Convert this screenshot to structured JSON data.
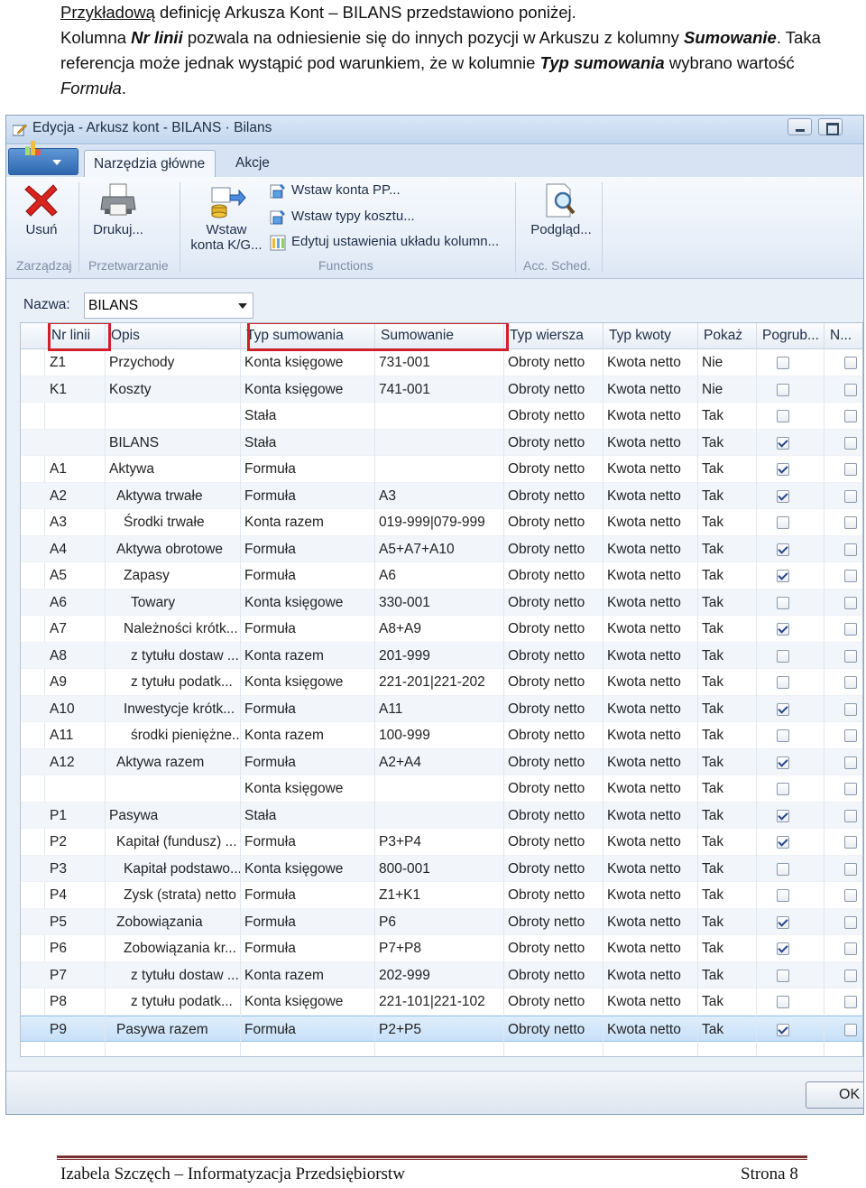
{
  "document": {
    "p1": {
      "underlined": "Przykładową",
      "rest": " definicję Arkusza Kont – BILANS przedstawiono poniżej."
    },
    "p2": {
      "t1": "Kolumna ",
      "b1": "Nr linii",
      "t2": " pozwala na odniesienie się do innych pozycji w Arkuszu z kolumny ",
      "b2": "Sumowanie",
      "t3": ". Taka referencja może jednak wystąpić pod warunkiem, że w kolumnie ",
      "b3": "Typ sumowania",
      "t4": " wybrano wartość ",
      "i1": "Formuła",
      "t5": "."
    }
  },
  "window": {
    "title": "Edycja - Arkusz kont - BILANS · Bilans",
    "tabs": [
      "Narzędzia główne",
      "Akcje"
    ],
    "ribbon": {
      "delete_label": "Usuń",
      "print_label": "Drukuj...",
      "insert_accounts_line1": "Wstaw",
      "insert_accounts_line2": "konta K/G...",
      "insert_pp_label": "Wstaw konta PP...",
      "insert_cost_types_label": "Wstaw typy kosztu...",
      "edit_layout_label": "Edytuj ustawienia układu kolumn...",
      "preview_label": "Podgląd...",
      "groups": {
        "manage": "Zarządzaj",
        "process": "Przetwarzanie",
        "functions": "Functions",
        "acc_sched": "Acc. Sched."
      }
    },
    "name_label": "Nazwa:",
    "name_value": "BILANS",
    "ok_label": "OK"
  },
  "grid": {
    "headers": [
      "Nr linii",
      "Opis",
      "Typ sumowania",
      "Sumowanie",
      "Typ wiersza",
      "Typ kwoty",
      "Pokaż",
      "Pogrub...",
      "N..."
    ],
    "rows": [
      {
        "nr": "Z1",
        "opis": "Przychody",
        "typ": "Konta księgowe",
        "sum": "731-001",
        "wiersz": "Obroty netto",
        "kwota": "Kwota netto",
        "pokaz": "Nie",
        "bold": false,
        "n": false
      },
      {
        "nr": "K1",
        "opis": "Koszty",
        "typ": "Konta księgowe",
        "sum": "741-001",
        "wiersz": "Obroty netto",
        "kwota": "Kwota netto",
        "pokaz": "Nie",
        "bold": false,
        "n": false
      },
      {
        "nr": "",
        "opis": "",
        "typ": "Stała",
        "sum": "",
        "wiersz": "Obroty netto",
        "kwota": "Kwota netto",
        "pokaz": "Tak",
        "bold": false,
        "n": false
      },
      {
        "nr": "",
        "opis": "BILANS",
        "typ": "Stała",
        "sum": "",
        "wiersz": "Obroty netto",
        "kwota": "Kwota netto",
        "pokaz": "Tak",
        "bold": true,
        "n": false
      },
      {
        "nr": "A1",
        "opis": "Aktywa",
        "typ": "Formuła",
        "sum": "",
        "wiersz": "Obroty netto",
        "kwota": "Kwota netto",
        "pokaz": "Tak",
        "bold": true,
        "n": false
      },
      {
        "nr": "A2",
        "opis": "Aktywa trwałe",
        "typ": "Formuła",
        "sum": "A3",
        "wiersz": "Obroty netto",
        "kwota": "Kwota netto",
        "pokaz": "Tak",
        "bold": true,
        "n": false
      },
      {
        "nr": "A3",
        "opis": "Środki trwałe",
        "typ": "Konta razem",
        "sum": "019-999|079-999",
        "wiersz": "Obroty netto",
        "kwota": "Kwota netto",
        "pokaz": "Tak",
        "bold": false,
        "n": false
      },
      {
        "nr": "A4",
        "opis": "Aktywa obrotowe",
        "typ": "Formuła",
        "sum": "A5+A7+A10",
        "wiersz": "Obroty netto",
        "kwota": "Kwota netto",
        "pokaz": "Tak",
        "bold": true,
        "n": false
      },
      {
        "nr": "A5",
        "opis": "Zapasy",
        "typ": "Formuła",
        "sum": "A6",
        "wiersz": "Obroty netto",
        "kwota": "Kwota netto",
        "pokaz": "Tak",
        "bold": true,
        "n": false
      },
      {
        "nr": "A6",
        "opis": "Towary",
        "typ": "Konta księgowe",
        "sum": "330-001",
        "wiersz": "Obroty netto",
        "kwota": "Kwota netto",
        "pokaz": "Tak",
        "bold": false,
        "n": false
      },
      {
        "nr": "A7",
        "opis": "Należności krótk...",
        "typ": "Formuła",
        "sum": "A8+A9",
        "wiersz": "Obroty netto",
        "kwota": "Kwota netto",
        "pokaz": "Tak",
        "bold": true,
        "n": false
      },
      {
        "nr": "A8",
        "opis": "z tytułu dostaw ...",
        "typ": "Konta razem",
        "sum": "201-999",
        "wiersz": "Obroty netto",
        "kwota": "Kwota netto",
        "pokaz": "Tak",
        "bold": false,
        "n": false
      },
      {
        "nr": "A9",
        "opis": "z tytułu podatk...",
        "typ": "Konta księgowe",
        "sum": "221-201|221-202",
        "wiersz": "Obroty netto",
        "kwota": "Kwota netto",
        "pokaz": "Tak",
        "bold": false,
        "n": false
      },
      {
        "nr": "A10",
        "opis": "Inwestycje krótk...",
        "typ": "Formuła",
        "sum": "A11",
        "wiersz": "Obroty netto",
        "kwota": "Kwota netto",
        "pokaz": "Tak",
        "bold": true,
        "n": false
      },
      {
        "nr": "A11",
        "opis": "środki pieniężne...",
        "typ": "Konta razem",
        "sum": "100-999",
        "wiersz": "Obroty netto",
        "kwota": "Kwota netto",
        "pokaz": "Tak",
        "bold": false,
        "n": false
      },
      {
        "nr": "A12",
        "opis": "Aktywa razem",
        "typ": "Formuła",
        "sum": "A2+A4",
        "wiersz": "Obroty netto",
        "kwota": "Kwota netto",
        "pokaz": "Tak",
        "bold": true,
        "n": false
      },
      {
        "nr": "",
        "opis": "",
        "typ": "Konta księgowe",
        "sum": "",
        "wiersz": "Obroty netto",
        "kwota": "Kwota netto",
        "pokaz": "Tak",
        "bold": false,
        "n": false
      },
      {
        "nr": "P1",
        "opis": "Pasywa",
        "typ": "Stała",
        "sum": "",
        "wiersz": "Obroty netto",
        "kwota": "Kwota netto",
        "pokaz": "Tak",
        "bold": true,
        "n": false
      },
      {
        "nr": "P2",
        "opis": "Kapitał (fundusz) ...",
        "typ": "Formuła",
        "sum": "P3+P4",
        "wiersz": "Obroty netto",
        "kwota": "Kwota netto",
        "pokaz": "Tak",
        "bold": true,
        "n": false
      },
      {
        "nr": "P3",
        "opis": "Kapitał podstawo...",
        "typ": "Konta księgowe",
        "sum": "800-001",
        "wiersz": "Obroty netto",
        "kwota": "Kwota netto",
        "pokaz": "Tak",
        "bold": false,
        "n": false
      },
      {
        "nr": "P4",
        "opis": "Zysk (strata) netto",
        "typ": "Formuła",
        "sum": "Z1+K1",
        "wiersz": "Obroty netto",
        "kwota": "Kwota netto",
        "pokaz": "Tak",
        "bold": false,
        "n": false
      },
      {
        "nr": "P5",
        "opis": "Zobowiązania",
        "typ": "Formuła",
        "sum": "P6",
        "wiersz": "Obroty netto",
        "kwota": "Kwota netto",
        "pokaz": "Tak",
        "bold": true,
        "n": false
      },
      {
        "nr": "P6",
        "opis": "Zobowiązania kr...",
        "typ": "Formuła",
        "sum": "P7+P8",
        "wiersz": "Obroty netto",
        "kwota": "Kwota netto",
        "pokaz": "Tak",
        "bold": true,
        "n": false
      },
      {
        "nr": "P7",
        "opis": "z tytułu dostaw ...",
        "typ": "Konta razem",
        "sum": "202-999",
        "wiersz": "Obroty netto",
        "kwota": "Kwota netto",
        "pokaz": "Tak",
        "bold": false,
        "n": false
      },
      {
        "nr": "P8",
        "opis": "z tytułu podatk...",
        "typ": "Konta księgowe",
        "sum": "221-101|221-102",
        "wiersz": "Obroty netto",
        "kwota": "Kwota netto",
        "pokaz": "Tak",
        "bold": false,
        "n": false
      },
      {
        "nr": "P9",
        "opis": "Pasywa razem",
        "typ": "Formuła",
        "sum": "P2+P5",
        "wiersz": "Obroty netto",
        "kwota": "Kwota netto",
        "pokaz": "Tak",
        "bold": true,
        "n": false,
        "selected": true
      }
    ]
  },
  "footer": {
    "left": "Izabela Szczęch – Informatyzacja Przedsiębiorstw",
    "right": "Strona 8"
  }
}
